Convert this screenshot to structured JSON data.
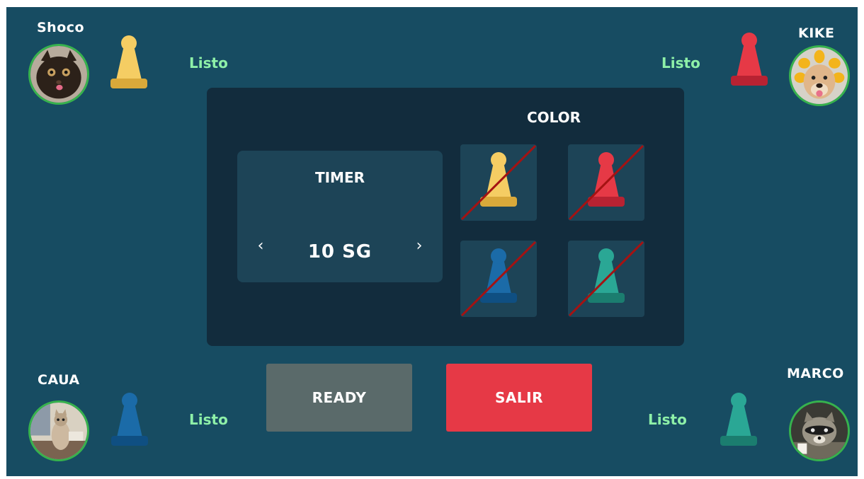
{
  "players": [
    {
      "id": "top-left",
      "name": "Shoco",
      "status": "Listo",
      "pawn_color": "#f5cd63",
      "pawn_shade": "#d9a93a",
      "avatar": "cat-photo"
    },
    {
      "id": "top-right",
      "name": "KIKE",
      "status": "Listo",
      "pawn_color": "#e63946",
      "pawn_shade": "#b82232",
      "avatar": "dog-photo"
    },
    {
      "id": "bottom-left",
      "name": "CAUA",
      "status": "Listo",
      "pawn_color": "#1b6ba8",
      "pawn_shade": "#0f4f82",
      "avatar": "cat-on-desk-photo"
    },
    {
      "id": "bottom-right",
      "name": "MARCO",
      "status": "Listo",
      "pawn_color": "#2aa795",
      "pawn_shade": "#1b7d6f",
      "avatar": "raccoon-photo"
    }
  ],
  "timer": {
    "title": "TIMER",
    "value": "10 SG",
    "prev_icon": "‹",
    "next_icon": "›"
  },
  "color": {
    "title": "COLOR",
    "options": [
      {
        "name": "yellow",
        "fill": "#f5cd63",
        "shade": "#d9a93a",
        "taken": true
      },
      {
        "name": "red",
        "fill": "#e63946",
        "shade": "#b82232",
        "taken": true
      },
      {
        "name": "blue",
        "fill": "#1b6ba8",
        "shade": "#0f4f82",
        "taken": true
      },
      {
        "name": "teal",
        "fill": "#2aa795",
        "shade": "#1b7d6f",
        "taken": true
      }
    ]
  },
  "buttons": {
    "ready": "READY",
    "exit": "SALIR"
  },
  "colors": {
    "background": "#174c62",
    "panel": "#122c3d",
    "card": "#1d4457",
    "ready_btn": "#5a6a6a",
    "exit_btn": "#e63946",
    "status_text": "#8ef0a8",
    "avatar_ring": "#37b24d",
    "strike": "#a51212"
  }
}
